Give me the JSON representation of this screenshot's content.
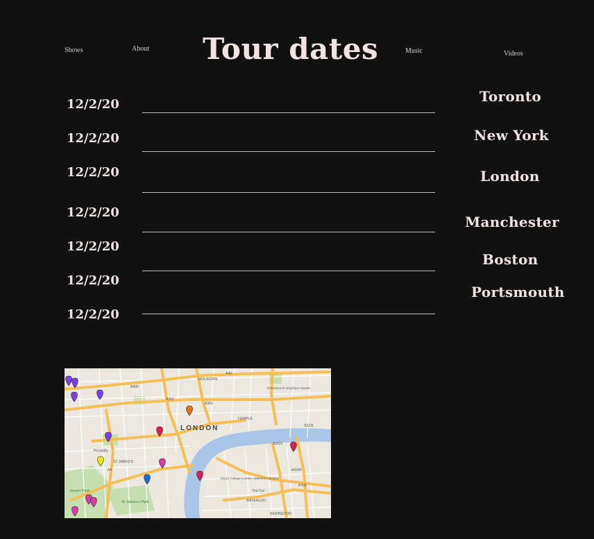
{
  "nav": {
    "shows": "Shows",
    "about": "About",
    "music": "Music",
    "videos": "Videos"
  },
  "page_title": "Tour dates",
  "tour": {
    "dates": [
      "12/2/20",
      "12/2/20",
      "12/2/20",
      "12/2/20",
      "12/2/20",
      "12/2/20",
      "12/2/20"
    ],
    "cities": [
      "Toronto",
      "New York",
      "London",
      "Manchester",
      "Boston",
      "Portsmouth"
    ]
  },
  "map": {
    "city_label": "LONDON",
    "labels": {
      "holborn": "HOLBORN",
      "temple": "TEMPLE",
      "st_james": "ST JAMES'S",
      "st_james_park": "St James's Park",
      "green_park": "Green Park",
      "waterloo": "WATERLOO",
      "newington": "NEWINGTON",
      "piccadilly": "Piccadilly",
      "christchurch": "Christchurch Greyfriars Garden",
      "kings_college": "King's College London, Waterloo Campus",
      "the_cut": "The Cut"
    },
    "roads": {
      "a40": "A40",
      "a400": "A400",
      "a4": "A4",
      "a3211": "A3211",
      "a3200": "A3200",
      "a3201": "A3201",
      "b300": "B300",
      "a301": "A301",
      "a302": "A302"
    },
    "colors": {
      "water": "#a9c5e8",
      "land": "#ece8df",
      "major_road": "#f6bf55",
      "minor_road": "#ffffff",
      "park": "#c6dfb0",
      "marker_purple": "#7b3fe4",
      "marker_red": "#d3224f",
      "marker_orange": "#e6730f",
      "marker_yellow": "#f3e31b",
      "marker_blue": "#1d6fd1",
      "marker_pink": "#d63ca6"
    }
  }
}
